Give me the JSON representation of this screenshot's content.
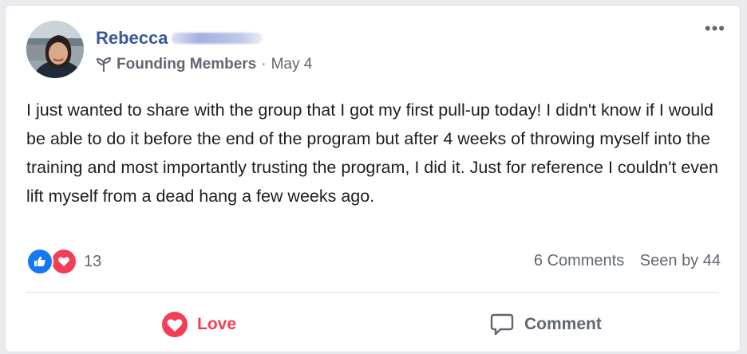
{
  "post": {
    "author": "Rebecca",
    "group_name": "Founding Members",
    "separator": "·",
    "date": "May 4",
    "more_label": "•••",
    "text": "I just wanted to share with the group that I got my first pull-up today! I didn't know if I would be able to do it before the end of the program but after 4 weeks of throwing myself into the training and most importantly trusting the program, I did it. Just for reference I couldn't even lift myself from a dead hang a few weeks ago."
  },
  "reactions": {
    "icons": [
      "like-icon",
      "love-icon"
    ],
    "count": "13"
  },
  "stats": {
    "comments": "6 Comments",
    "seen": "Seen by 44"
  },
  "actions": {
    "love_label": "Love",
    "comment_label": "Comment"
  },
  "colors": {
    "author": "#385898",
    "love": "#f33e58",
    "like": "#1877f2",
    "muted": "#606770"
  }
}
